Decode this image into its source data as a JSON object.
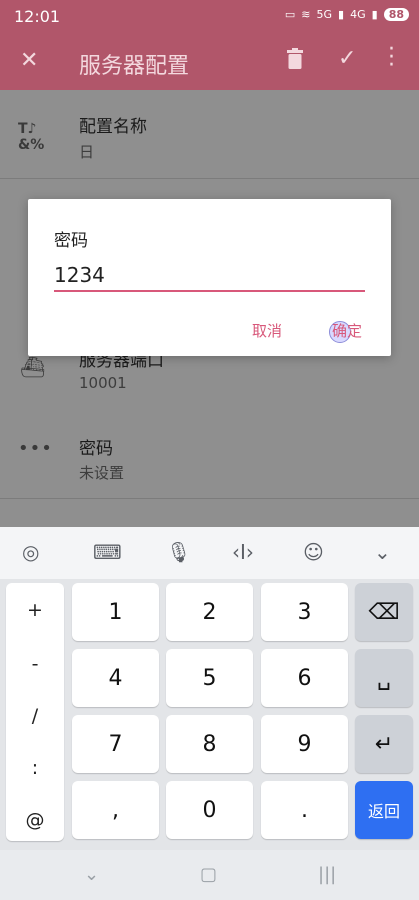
{
  "status": {
    "time": "12:01",
    "battery": "88",
    "net_5g": "5G",
    "net_4g": "4G"
  },
  "appbar": {
    "title": "服务器配置"
  },
  "list": [
    {
      "label": "配置名称",
      "value": "日"
    },
    {
      "label": "服务器端口",
      "value": "10001"
    },
    {
      "label": "密码",
      "value": "未设置"
    }
  ],
  "dialog": {
    "title": "密码",
    "input_value": "1234",
    "cancel": "取消",
    "ok": "确定"
  },
  "keyboard": {
    "side": [
      "+",
      "-",
      "/",
      ":",
      "@"
    ],
    "rows": [
      [
        "1",
        "2",
        "3"
      ],
      [
        "4",
        "5",
        "6"
      ],
      [
        "7",
        "8",
        "9"
      ],
      [
        ",",
        "0",
        "."
      ]
    ],
    "enter_label": "返回"
  },
  "colors": {
    "accent": "#d8587a",
    "appbar_dimmed": "#b1566a",
    "enter_key": "#2e6ff2"
  }
}
